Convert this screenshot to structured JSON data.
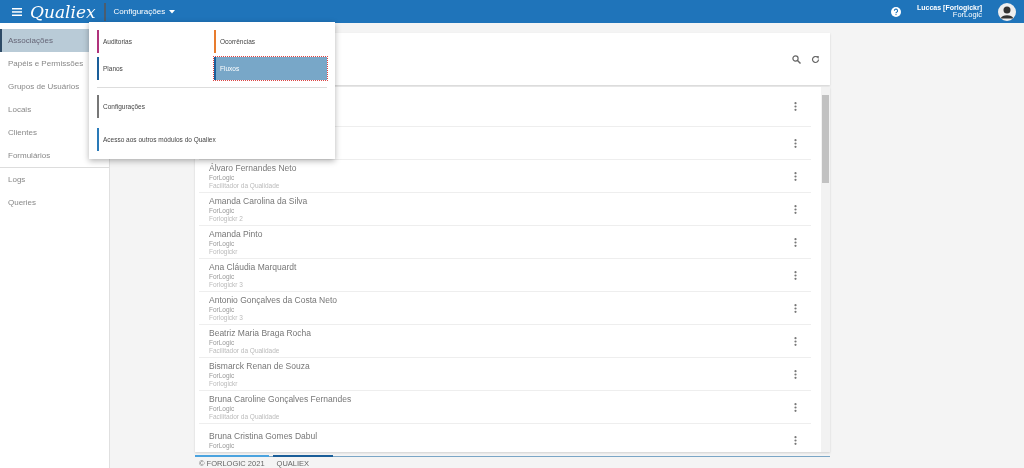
{
  "navbar": {
    "brand": "Qualiex",
    "module_menu": "Configurações",
    "user_name": "Luccas [Forlogickr]",
    "user_company": "ForLogic"
  },
  "sidebar": {
    "items": [
      {
        "label": "Associações",
        "selected": true,
        "divider_after": false
      },
      {
        "label": "Papéis e Permissões",
        "selected": false,
        "divider_after": false
      },
      {
        "label": "Grupos de Usuários",
        "selected": false,
        "divider_after": false
      },
      {
        "label": "Locais",
        "selected": false,
        "divider_after": false
      },
      {
        "label": "Clientes",
        "selected": false,
        "divider_after": false
      },
      {
        "label": "Formulários",
        "selected": false,
        "divider_after": true
      },
      {
        "label": "Logs",
        "selected": false,
        "divider_after": false
      },
      {
        "label": "Queries",
        "selected": false,
        "divider_after": false
      }
    ]
  },
  "dropdown": {
    "groups": [
      [
        {
          "label": "Auditorias",
          "color": "#b0337c",
          "selected": false
        },
        {
          "label": "Ocorrências",
          "color": "#e87c2e",
          "selected": false
        },
        {
          "label": "Planos",
          "color": "#1a5e99",
          "selected": false
        },
        {
          "label": "Fluxos",
          "color": "#1a5e99",
          "selected": true
        }
      ],
      [
        {
          "label": "Configurações",
          "color": "#777777",
          "selected": false
        },
        {
          "label": "Acesso aos outros módulos do Qualiex",
          "color": "#2a7ab8",
          "selected": false
        }
      ]
    ]
  },
  "list": {
    "rows": [
      {
        "kind": "covered"
      },
      {
        "kind": "covered"
      },
      {
        "kind": "person",
        "name": "Álvaro Fernandes Neto",
        "company": "ForLogic",
        "role": "Facilitador da Qualidade"
      },
      {
        "kind": "person",
        "name": "Amanda Carolina da Silva",
        "company": "ForLogic",
        "role": "Forlogickr 2"
      },
      {
        "kind": "person",
        "name": "Amanda Pinto",
        "company": "ForLogic",
        "role": "Forlogickr"
      },
      {
        "kind": "person",
        "name": "Ana Cláudia Marquardt",
        "company": "ForLogic",
        "role": "Forlogickr 3"
      },
      {
        "kind": "person",
        "name": "Antonio Gonçalves da Costa Neto",
        "company": "ForLogic",
        "role": "Forlogickr 3"
      },
      {
        "kind": "person",
        "name": "Beatriz Maria Braga Rocha",
        "company": "ForLogic",
        "role": "Facilitador da Qualidade"
      },
      {
        "kind": "person",
        "name": "Bismarck Renan de Souza",
        "company": "ForLogic",
        "role": "Forlogickr"
      },
      {
        "kind": "person",
        "name": "Bruna Caroline Gonçalves Fernandes",
        "company": "ForLogic",
        "role": "Facilitador da Qualidade"
      },
      {
        "kind": "person",
        "name": "Bruna Cristina Gomes Dabul",
        "company": "ForLogic"
      }
    ]
  },
  "footer": {
    "items": [
      {
        "label": "© FORLOGIC 2021",
        "color": "#4aa3df"
      },
      {
        "label": "QUALIEX",
        "color": "#1a5e99"
      }
    ]
  }
}
